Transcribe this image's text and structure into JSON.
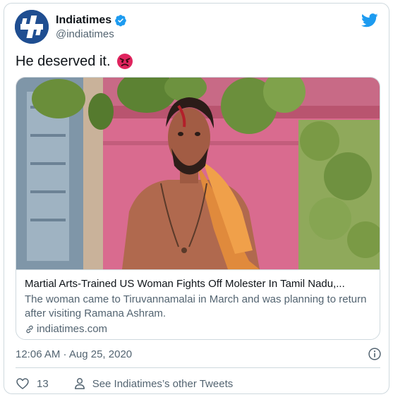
{
  "author": {
    "display_name": "Indiatimes",
    "handle": "@indiatimes",
    "verified": true,
    "avatar_color": "#1f4e91"
  },
  "tweet": {
    "text": "He deserved it.",
    "emoji": "angry-face"
  },
  "link_card": {
    "title": "Martial Arts-Trained US Woman Fights Off Molester In Tamil Nadu,...",
    "description": "The woman came to Tiruvannamalai in March and was planning to return after visiting Ramana Ashram.",
    "domain": "indiatimes.com"
  },
  "footer": {
    "timestamp": "12:06 AM · Aug 25, 2020",
    "like_count": "13",
    "profile_link_label": "See Indiatimes’s other Tweets"
  },
  "colors": {
    "twitter_blue": "#1d9bf0",
    "secondary_text": "#536471",
    "border": "#cfd9de",
    "angry_red": "#e0245e"
  },
  "icons": [
    "twitter-bird-icon",
    "verified-badge-icon",
    "angry-face-icon",
    "link-icon",
    "info-icon",
    "heart-icon",
    "person-icon"
  ]
}
